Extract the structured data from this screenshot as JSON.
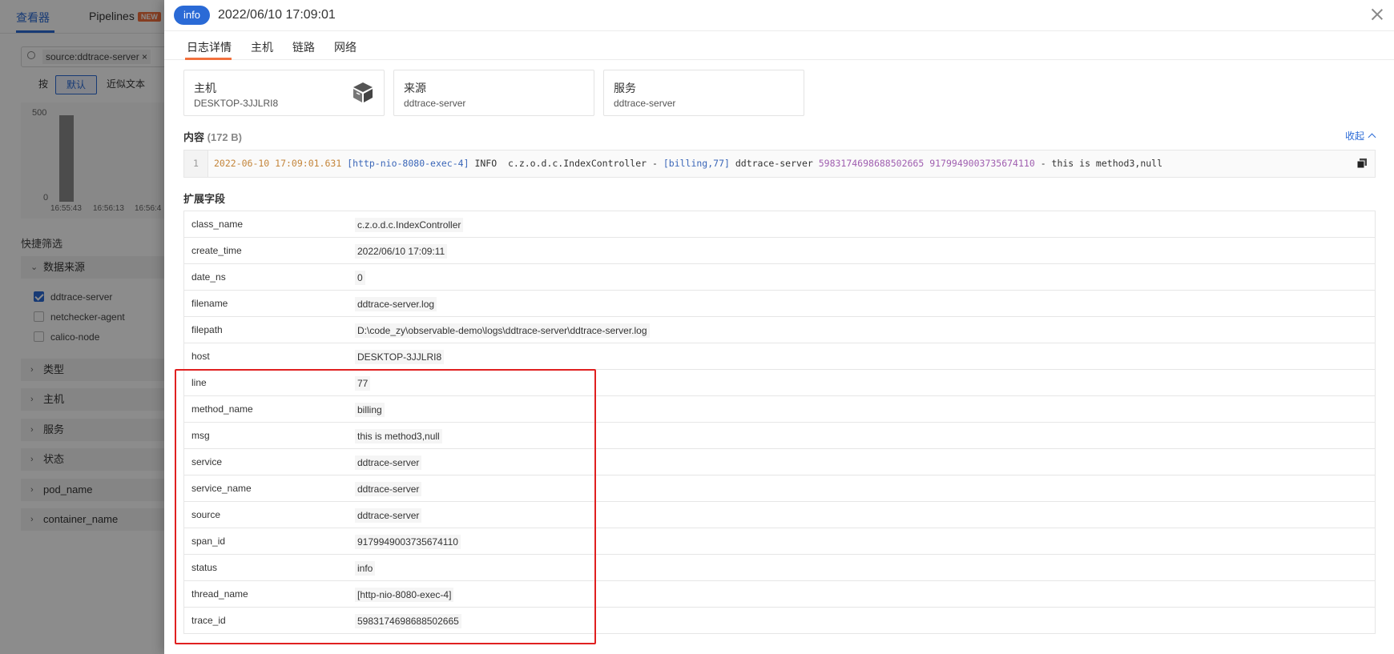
{
  "background": {
    "tabs": [
      "查看器",
      "Pipelines"
    ],
    "new_badge": "NEW",
    "search_chip": "source:ddtrace-server",
    "mode_prefix": "按",
    "modes": [
      "默认",
      "近似文本"
    ],
    "chart": {
      "y_ticks": [
        "500",
        "0"
      ],
      "x_ticks": [
        "16:55:43",
        "16:56:13",
        "16:56:4"
      ]
    },
    "quick_filter_title": "快捷筛选",
    "data_source_group": "数据来源",
    "sources": [
      {
        "name": "ddtrace-server",
        "checked": true
      },
      {
        "name": "netchecker-agent",
        "checked": false
      },
      {
        "name": "calico-node",
        "checked": false
      }
    ],
    "groups": [
      "类型",
      "主机",
      "服务",
      "状态",
      "pod_name",
      "container_name"
    ]
  },
  "drawer": {
    "status": "info",
    "time": "2022/06/10 17:09:01",
    "tabs": [
      "日志详情",
      "主机",
      "链路",
      "网络"
    ],
    "cards": [
      {
        "label": "主机",
        "value": "DESKTOP-3JJLRI8",
        "icon": "cube-icon"
      },
      {
        "label": "来源",
        "value": "ddtrace-server"
      },
      {
        "label": "服务",
        "value": "ddtrace-server"
      }
    ],
    "content_title": "内容",
    "content_size": "(172 B)",
    "collapse_label": "收起",
    "code": {
      "line_number": "1",
      "timestamp": "2022-06-10 17:09:01.631",
      "thread": "[http-nio-8080-exec-4]",
      "level": " INFO  c.z.o.d.c.IndexController - ",
      "context": "[billing,77]",
      "service": " ddtrace-server ",
      "trace_id": "5983174698688502665",
      "span_id": " 9179949003735674110",
      "message": " - this is method3,null"
    },
    "ext_title": "扩展字段",
    "fields": [
      {
        "key": "class_name",
        "value": "c.z.o.d.c.IndexController"
      },
      {
        "key": "create_time",
        "value": "2022/06/10 17:09:11"
      },
      {
        "key": "date_ns",
        "value": "0"
      },
      {
        "key": "filename",
        "value": "ddtrace-server.log"
      },
      {
        "key": "filepath",
        "value": "D:\\code_zy\\observable-demo\\logs\\ddtrace-server\\ddtrace-server.log"
      },
      {
        "key": "host",
        "value": "DESKTOP-3JJLRI8"
      },
      {
        "key": "line",
        "value": "77"
      },
      {
        "key": "method_name",
        "value": "billing"
      },
      {
        "key": "msg",
        "value": "this is method3,null"
      },
      {
        "key": "service",
        "value": "ddtrace-server"
      },
      {
        "key": "service_name",
        "value": "ddtrace-server"
      },
      {
        "key": "source",
        "value": "ddtrace-server"
      },
      {
        "key": "span_id",
        "value": "9179949003735674110"
      },
      {
        "key": "status",
        "value": "info"
      },
      {
        "key": "thread_name",
        "value": "[http-nio-8080-exec-4]"
      },
      {
        "key": "trace_id",
        "value": "5983174698688502665"
      }
    ],
    "colors": {
      "accent": "#2a6ad6",
      "tab_underline": "#f2703d",
      "highlight": "#e02020"
    }
  }
}
